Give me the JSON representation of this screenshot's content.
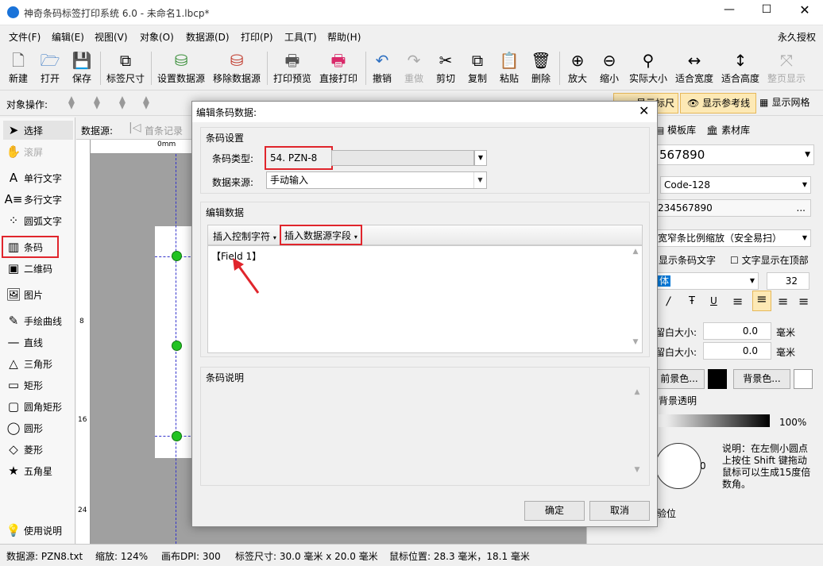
{
  "window": {
    "title": "神奇条码标签打印系统 6.0 - 未命名1.lbcp*"
  },
  "menu": {
    "items": [
      "文件(F)",
      "编辑(E)",
      "视图(V)",
      "对象(O)",
      "数据源(D)",
      "打印(P)",
      "工具(T)",
      "帮助(H)"
    ],
    "right": "永久授权"
  },
  "toolbar": {
    "items": [
      {
        "label": "新建",
        "icon": "new-file-icon"
      },
      {
        "label": "打开",
        "icon": "open-icon"
      },
      {
        "label": "保存",
        "icon": "save-icon"
      },
      {
        "label": "标签尺寸",
        "icon": "label-size-icon"
      },
      {
        "label": "设置数据源",
        "icon": "database-icon"
      },
      {
        "label": "移除数据源",
        "icon": "database-remove-icon"
      },
      {
        "label": "打印预览",
        "icon": "print-preview-icon"
      },
      {
        "label": "直接打印",
        "icon": "printer-icon"
      },
      {
        "label": "撤销",
        "icon": "undo-icon"
      },
      {
        "label": "重做",
        "icon": "redo-icon"
      },
      {
        "label": "剪切",
        "icon": "cut-icon"
      },
      {
        "label": "复制",
        "icon": "copy-icon"
      },
      {
        "label": "粘贴",
        "icon": "paste-icon"
      },
      {
        "label": "删除",
        "icon": "delete-icon"
      },
      {
        "label": "放大",
        "icon": "zoom-in-icon"
      },
      {
        "label": "缩小",
        "icon": "zoom-out-icon"
      },
      {
        "label": "实际大小",
        "icon": "actual-size-icon"
      },
      {
        "label": "适合宽度",
        "icon": "fit-width-icon"
      },
      {
        "label": "适合高度",
        "icon": "fit-height-icon"
      },
      {
        "label": "整页显示",
        "icon": "full-page-icon"
      }
    ]
  },
  "objbar": {
    "label": "对象操作:",
    "show_ruler": "显示标尺",
    "show_guides": "显示参考线",
    "show_grid": "显示网格"
  },
  "left_tools": [
    "选择",
    "滚屏",
    "单行文字",
    "多行文字",
    "圆弧文字",
    "条码",
    "二维码",
    "图片",
    "手绘曲线",
    "直线",
    "三角形",
    "矩形",
    "圆角矩形",
    "圆形",
    "菱形",
    "五角星",
    "使用说明"
  ],
  "datasource_bar": {
    "label": "数据源:",
    "first": "首条记录"
  },
  "ruler": {
    "h0": "0mm",
    "v": [
      "8",
      "16",
      "24"
    ]
  },
  "right_panel": {
    "tabs": [
      "模板库",
      "素材库"
    ],
    "barcode_value": "567890",
    "type": "Code-128",
    "data": "234567890",
    "scale": "宽窄条比例缩放（安全易扫）",
    "show_text": "显示条码文字",
    "text_top": "文字显示在顶部",
    "font": "体",
    "font_size": "32",
    "margin1_label": "留白大小:",
    "margin1_val": "0.0",
    "margin2_label": "留白大小:",
    "margin2_val": "0.0",
    "unit": "毫米",
    "fg": "前景色...",
    "bg": "背景色...",
    "transparent": "背景透明",
    "opacity": "100%",
    "angle": "0",
    "note": "说明：在左侧小圆点上按住 Shift 键拖动鼠标可以生成15度倍数角。",
    "check": "验位"
  },
  "dialog": {
    "title": "编辑条码数据:",
    "group1": "条码设置",
    "type_label": "条码类型:",
    "type_value": "54. PZN-8",
    "source_label": "数据来源:",
    "source_value": "手动输入",
    "group2": "编辑数据",
    "insert_ctrl": "插入控制字符",
    "insert_field": "插入数据源字段",
    "content": "【Field 1】",
    "group3": "条码说明",
    "ok": "确定",
    "cancel": "取消"
  },
  "status": {
    "source": "数据源: PZN8.txt",
    "zoom": "缩放: 124%",
    "dpi": "画布DPI: 300",
    "size": "标签尺寸: 30.0 毫米 x 20.0 毫米",
    "mouse": "鼠标位置: 28.3 毫米，18.1 毫米"
  },
  "colors": {
    "accent": "#0078d7",
    "highlight": "#e0252c",
    "node": "#22c322"
  }
}
